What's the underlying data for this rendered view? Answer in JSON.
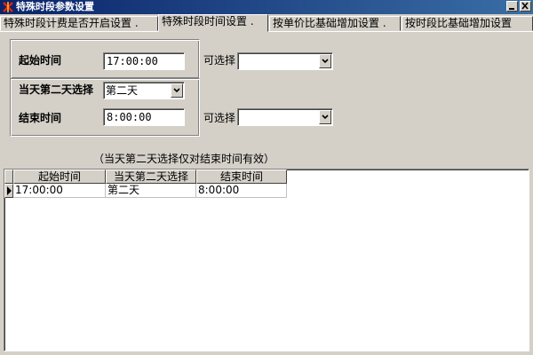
{
  "window": {
    "title": "特殊时段参数设置",
    "icon": "app-icon",
    "controls": [
      "minimize",
      "close"
    ]
  },
  "tabs": [
    {
      "label": "特殊时段计费是否开启设置 .",
      "active": false
    },
    {
      "label": "特殊时段时间设置 .",
      "active": true
    },
    {
      "label": "按单价比基础增加设置 .",
      "active": false
    },
    {
      "label": "按时段比基础增加设置",
      "active": false
    }
  ],
  "form": {
    "start_label": "起始时间",
    "start_value": "17:00:00",
    "start_optional_label": "可选择",
    "start_optional_value": "",
    "day_label": "当天第二天选择",
    "day_value": "第二天",
    "end_label": "结束时间",
    "end_value": "8:00:00",
    "end_optional_label": "可选择",
    "end_optional_value": ""
  },
  "note": "（当天第二天选择仅对结束时间有效）",
  "grid": {
    "columns": [
      "起始时间",
      "当天第二天选择",
      "结束时间"
    ],
    "rows": [
      [
        "17:00:00",
        "第二天",
        "8:00:00"
      ]
    ]
  },
  "colors": {
    "title_start": "#0a246a",
    "title_end": "#3a6ea5",
    "face": "#d4d0c8"
  }
}
